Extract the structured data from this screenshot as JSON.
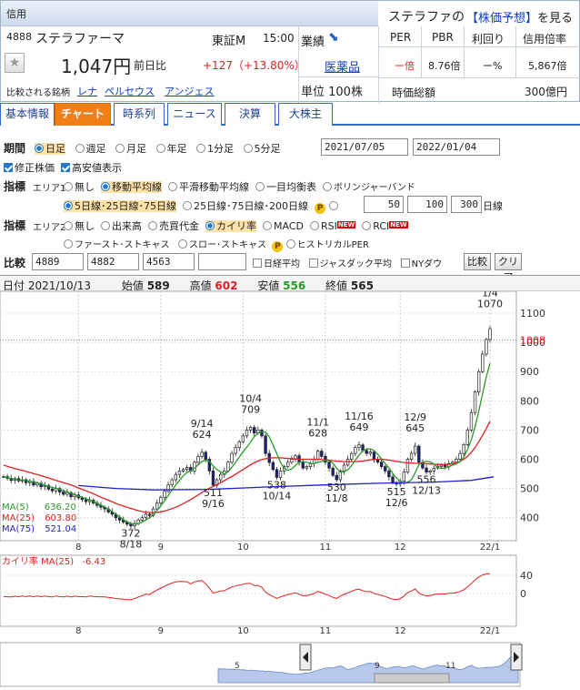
{
  "header": {
    "credit": "信用",
    "code": "4888",
    "name": "ステラファーマ",
    "market": "東証M",
    "time": "15:00",
    "company_name_full": "ステラファの",
    "forecast_label": "【株価予想】",
    "forecast_suffix": "を見る",
    "price": "1,047円",
    "change_label": "前日比",
    "change": "+127（+13.80%）",
    "gyoseki": "業績",
    "sector": "医薬品",
    "unit": "単位 100株",
    "compare_label": "比較される銘柄",
    "compare": [
      "レナ",
      "ペルセウス",
      "アンジェス"
    ],
    "per_label": "PER",
    "pbr_label": "PBR",
    "yield_label": "利回り",
    "margin_label": "信用倍率",
    "per": "ー倍",
    "pbr": "8.76倍",
    "yield": "ー%",
    "margin": "5,867倍",
    "mcap_label": "時価総額",
    "mcap": "300億円"
  },
  "tabs": [
    "基本情報",
    "チャート",
    "時系列",
    "ニュース",
    "決算",
    "大株主"
  ],
  "controls": {
    "period_label": "期間",
    "periods": [
      "日足",
      "週足",
      "月足",
      "年足",
      "1分足",
      "5分足"
    ],
    "date_from": "2021/07/05",
    "date_to": "2022/01/04",
    "adj_label": "修正株価",
    "hl_label": "高安値表示",
    "ind_label": "指標",
    "area1": "エリア1",
    "area2": "エリア2",
    "a1_opts": [
      "無し",
      "移動平均線",
      "平滑移動平均線",
      "一目均衡表",
      "ボリンジャーバンド"
    ],
    "ma_set1": "5日線･25日線･75日線",
    "ma_set2": "25日線･75日線･200日線",
    "ma_custom": [
      "50",
      "100",
      "300"
    ],
    "day": "日線",
    "a2_opts": [
      "無し",
      "出来高",
      "売買代金",
      "カイリ率",
      "MACD",
      "RSI",
      "RCI"
    ],
    "a2_opts2": [
      "ファースト･ストキャス",
      "スロー･ストキャス",
      "ヒストリカルPER"
    ],
    "new_badge": "NEW",
    "p_badge": "P",
    "cmp_label": "比較",
    "cmp_codes": [
      "4889",
      "4882",
      "4563",
      ""
    ],
    "cmp_opts": [
      "日経平均",
      "ジャスダック平均",
      "NYダウ"
    ],
    "cmp_btn": "比較",
    "clear_btn": "クリア"
  },
  "ohlc": {
    "date_label": "日付",
    "date": "2021/10/13",
    "open_label": "始値",
    "open": "589",
    "high_label": "高値",
    "high": "602",
    "low_label": "安値",
    "low": "556",
    "close_label": "終値",
    "close": "565"
  },
  "chart_data": {
    "type": "candlestick",
    "x_ticks": [
      "8",
      "9",
      "10",
      "11",
      "12",
      "22/1"
    ],
    "y_ticks": [
      "1100",
      "1000",
      "900",
      "800",
      "700",
      "600",
      "500",
      "400"
    ],
    "ylim": [
      340,
      1150
    ],
    "last_price": "1008",
    "annotations": [
      {
        "label": "372",
        "sub": "8/18",
        "x": "8/18",
        "y": 372
      },
      {
        "label": "9/14",
        "sub": "624",
        "x": "9/14",
        "y": 624
      },
      {
        "label": "511",
        "sub": "9/16",
        "x": "9/16",
        "y": 511
      },
      {
        "label": "10/4",
        "sub": "709",
        "x": "10/4",
        "y": 709
      },
      {
        "label": "538",
        "sub": "10/14",
        "x": "10/14",
        "y": 538
      },
      {
        "label": "11/1",
        "sub": "628",
        "x": "11/1",
        "y": 628
      },
      {
        "label": "530",
        "sub": "11/8",
        "x": "11/8",
        "y": 530
      },
      {
        "label": "11/16",
        "sub": "649",
        "x": "11/16",
        "y": 649
      },
      {
        "label": "12/9",
        "sub": "645",
        "x": "12/9",
        "y": 645
      },
      {
        "label": "515",
        "sub": "12/6",
        "x": "12/6",
        "y": 515
      },
      {
        "label": "556",
        "sub": "12/13",
        "x": "12/13",
        "y": 556
      },
      {
        "label": "1/4",
        "sub": "1070",
        "x": "1/4",
        "y": 1070
      }
    ],
    "ma_legend": [
      {
        "name": "MA(5)",
        "value": "636.20",
        "color": "#2a9a2a"
      },
      {
        "name": "MA(25)",
        "value": "603.80",
        "color": "#e02020"
      },
      {
        "name": "MA(75)",
        "value": "521.04",
        "color": "#2020d0"
      }
    ],
    "close": [
      541,
      535,
      528,
      534,
      526,
      530,
      520,
      524,
      512,
      518,
      506,
      510,
      498,
      492,
      500,
      488,
      480,
      486,
      472,
      478,
      468,
      462,
      455,
      460,
      450,
      442,
      436,
      430,
      420,
      412,
      400,
      392,
      385,
      378,
      372,
      380,
      392,
      400,
      412,
      408,
      430,
      450,
      470,
      490,
      512,
      530,
      548,
      560,
      565,
      572,
      560,
      590,
      610,
      624,
      600,
      560,
      511,
      530,
      548,
      560,
      590,
      620,
      640,
      660,
      680,
      700,
      709,
      690,
      700,
      680,
      620,
      589,
      565,
      538,
      560,
      575,
      590,
      600,
      612,
      590,
      570,
      575,
      585,
      600,
      628,
      610,
      590,
      570,
      545,
      530,
      560,
      580,
      600,
      620,
      640,
      649,
      630,
      620,
      625,
      600,
      590,
      575,
      560,
      540,
      520,
      515,
      525,
      556,
      600,
      620,
      645,
      590,
      570,
      556,
      560,
      570,
      575,
      580,
      575,
      585,
      590,
      600,
      620,
      650,
      700,
      760,
      830,
      900,
      960,
      1010,
      1047
    ],
    "ma5": [
      540,
      538,
      534,
      532,
      530,
      529,
      527,
      525,
      522,
      520,
      516,
      512,
      507,
      503,
      501,
      497,
      492,
      489,
      484,
      479,
      474,
      470,
      465,
      461,
      456,
      449,
      443,
      437,
      429,
      421,
      412,
      403,
      394,
      386,
      380,
      378,
      380,
      385,
      392,
      400,
      410,
      424,
      440,
      458,
      476,
      494,
      512,
      528,
      543,
      555,
      561,
      569,
      581,
      592,
      597,
      593,
      577,
      565,
      557,
      549,
      558,
      572,
      590,
      608,
      626,
      642,
      659,
      677,
      690,
      695,
      693,
      677,
      649,
      620,
      590,
      569,
      562,
      567,
      579,
      590,
      592,
      590,
      586,
      585,
      590,
      592,
      596,
      596,
      587,
      569,
      557,
      557,
      564,
      578,
      597,
      615,
      629,
      634,
      636,
      630,
      617,
      601,
      585,
      570,
      552,
      536,
      524,
      517,
      522,
      530,
      554,
      582,
      590,
      593,
      591,
      584,
      572,
      569,
      570,
      574,
      580,
      585,
      592,
      608,
      634,
      666,
      710,
      766,
      824,
      882,
      929
    ],
    "ma25": [
      580,
      576,
      572,
      568,
      565,
      562,
      558,
      555,
      551,
      548,
      544,
      540,
      536,
      532,
      528,
      524,
      520,
      516,
      512,
      507,
      502,
      497,
      492,
      487,
      482,
      476,
      470,
      465,
      460,
      455,
      449,
      444,
      440,
      436,
      432,
      428,
      424,
      421,
      419,
      418,
      417,
      418,
      420,
      423,
      427,
      431,
      436,
      442,
      448,
      455,
      462,
      470,
      478,
      486,
      494,
      501,
      507,
      513,
      520,
      527,
      534,
      541,
      549,
      557,
      565,
      573,
      581,
      588,
      594,
      599,
      602,
      604,
      605,
      605,
      605,
      604,
      603,
      602,
      601,
      600,
      600,
      600,
      600,
      600,
      600,
      599,
      598,
      597,
      595,
      594,
      593,
      592,
      592,
      592,
      592,
      593,
      594,
      596,
      598,
      599,
      600,
      600,
      599,
      597,
      595,
      593,
      591,
      589,
      588,
      587,
      586,
      586,
      586,
      585,
      584,
      583,
      582,
      582,
      582,
      583,
      585,
      588,
      593,
      600,
      610,
      624,
      640,
      660,
      682,
      705,
      730
    ],
    "ma75": [
      null,
      null,
      null,
      null,
      null,
      null,
      null,
      null,
      null,
      null,
      null,
      null,
      null,
      null,
      null,
      null,
      null,
      null,
      null,
      null,
      null,
      null,
      null,
      null,
      null,
      null,
      null,
      null,
      null,
      null,
      null,
      null,
      null,
      null,
      null,
      null,
      null,
      null,
      null,
      null,
      null,
      null,
      null,
      null,
      null,
      null,
      null,
      null,
      null,
      null,
      null,
      null,
      null,
      null,
      null,
      null,
      null,
      null,
      null,
      null,
      null,
      null,
      null,
      null,
      null,
      null,
      null,
      null,
      null,
      null,
      null,
      null,
      null,
      null,
      null,
      null,
      null,
      null,
      null,
      null,
      null,
      null,
      null,
      null,
      null,
      null,
      null,
      null,
      null,
      null,
      null,
      null,
      null,
      null,
      null,
      null,
      null,
      null,
      null,
      null,
      null,
      null,
      null,
      null,
      null,
      null,
      null,
      null,
      null,
      null,
      null,
      null,
      null,
      null,
      null,
      null,
      null,
      null,
      null,
      null,
      null,
      null,
      null,
      null,
      null,
      null,
      null,
      null,
      null,
      null,
      null
    ],
    "ma75_points": [
      [
        20,
        510
      ],
      [
        30,
        500
      ],
      [
        40,
        495
      ],
      [
        55,
        497
      ],
      [
        70,
        505
      ],
      [
        85,
        512
      ],
      [
        100,
        518
      ],
      [
        115,
        522
      ],
      [
        125,
        528
      ],
      [
        131,
        540
      ]
    ],
    "kairi_label": "カイリ率 MA(25)",
    "kairi_value": "-6.43",
    "kairi_ticks": [
      "40",
      "0"
    ],
    "nav_ticks": [
      "5",
      "9",
      "11"
    ]
  }
}
